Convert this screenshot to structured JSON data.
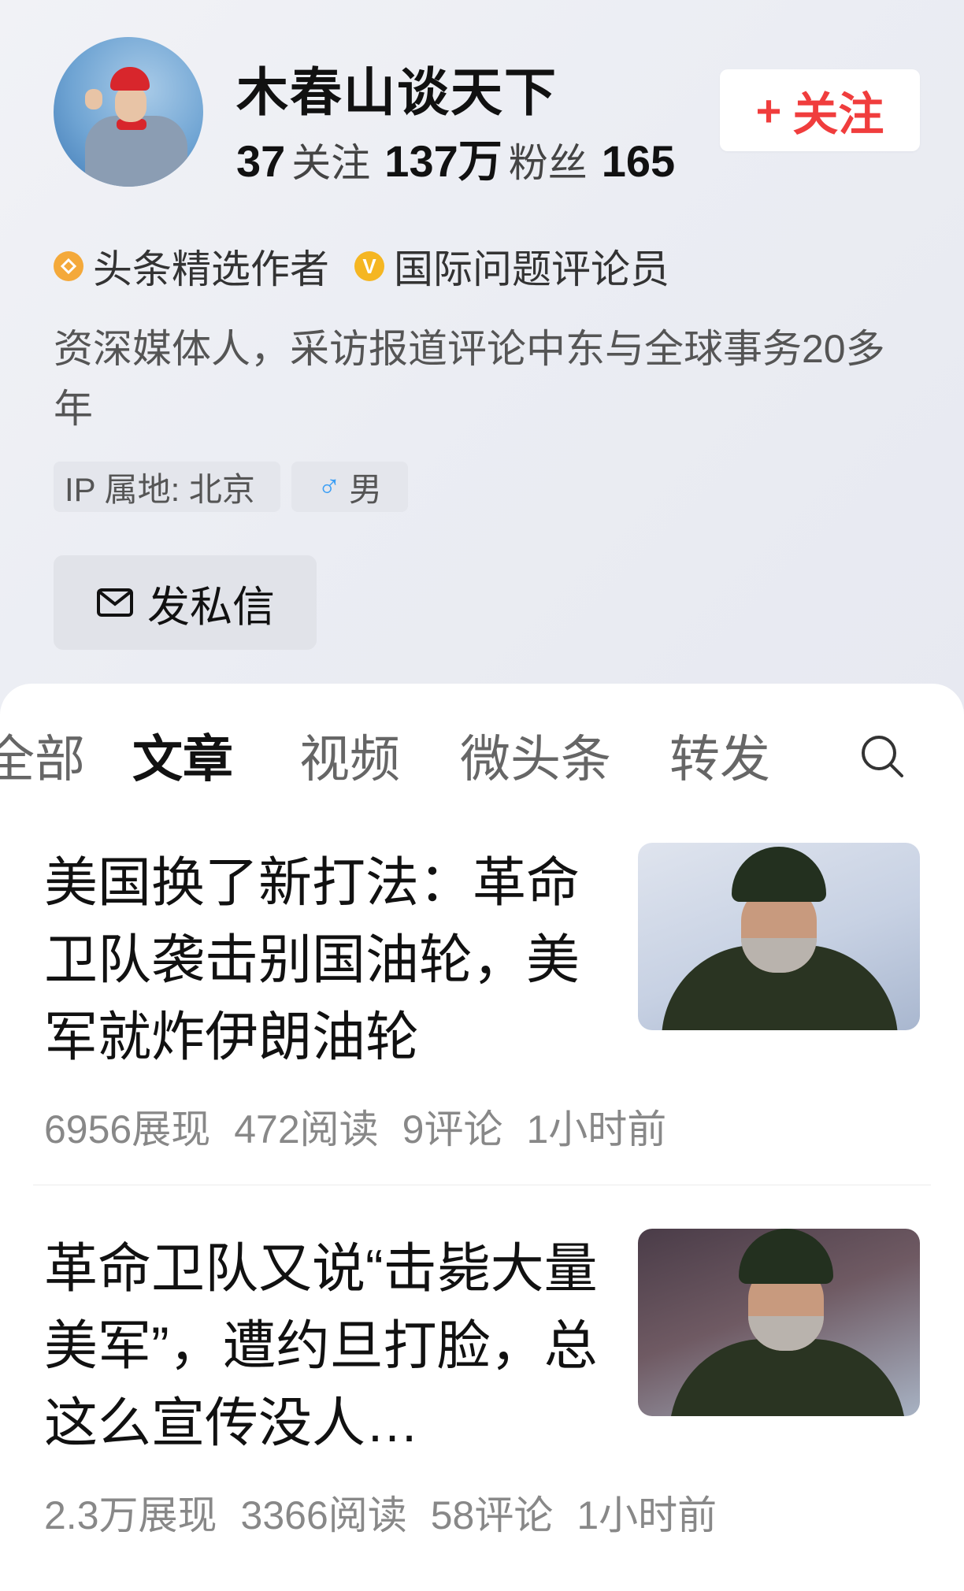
{
  "profile": {
    "name": "木春山谈天下",
    "following_count": "37",
    "following_label": "关注",
    "fans_count": "137万",
    "fans_label": "粉丝",
    "likes_partial": "165",
    "follow_button_plus": "+",
    "follow_button_label": "关注",
    "badges": [
      {
        "icon": "author-badge-icon",
        "label": "头条精选作者"
      },
      {
        "icon": "verified-v-icon",
        "icon_text": "V",
        "label": "国际问题评论员"
      }
    ],
    "bio": "资深媒体人，采访报道评论中东与全球事务20多年",
    "ip_location": "IP 属地: 北京",
    "gender_symbol": "♂",
    "gender": "男",
    "message_button_label": "发私信"
  },
  "tabs": [
    {
      "label": "全部",
      "active": false
    },
    {
      "label": "文章",
      "active": true
    },
    {
      "label": "视频",
      "active": false
    },
    {
      "label": "微头条",
      "active": false
    },
    {
      "label": "转发",
      "active": false
    }
  ],
  "articles": [
    {
      "title": "美国换了新打法：革命卫队袭击别国油轮，美军就炸伊朗油轮",
      "impressions": "6956展现",
      "reads": "472阅读",
      "comments": "9评论",
      "time": "1小时前"
    },
    {
      "title": "革命卫队又说“击毙大量美军”，遭约旦打脸，总这么宣传没人…",
      "impressions": "2.3万展现",
      "reads": "3366阅读",
      "comments": "58评论",
      "time": "1小时前"
    }
  ],
  "colors": {
    "accent_red": "#f03d3d",
    "verified_gold": "#f5b622",
    "male_blue": "#3a9ef5"
  }
}
